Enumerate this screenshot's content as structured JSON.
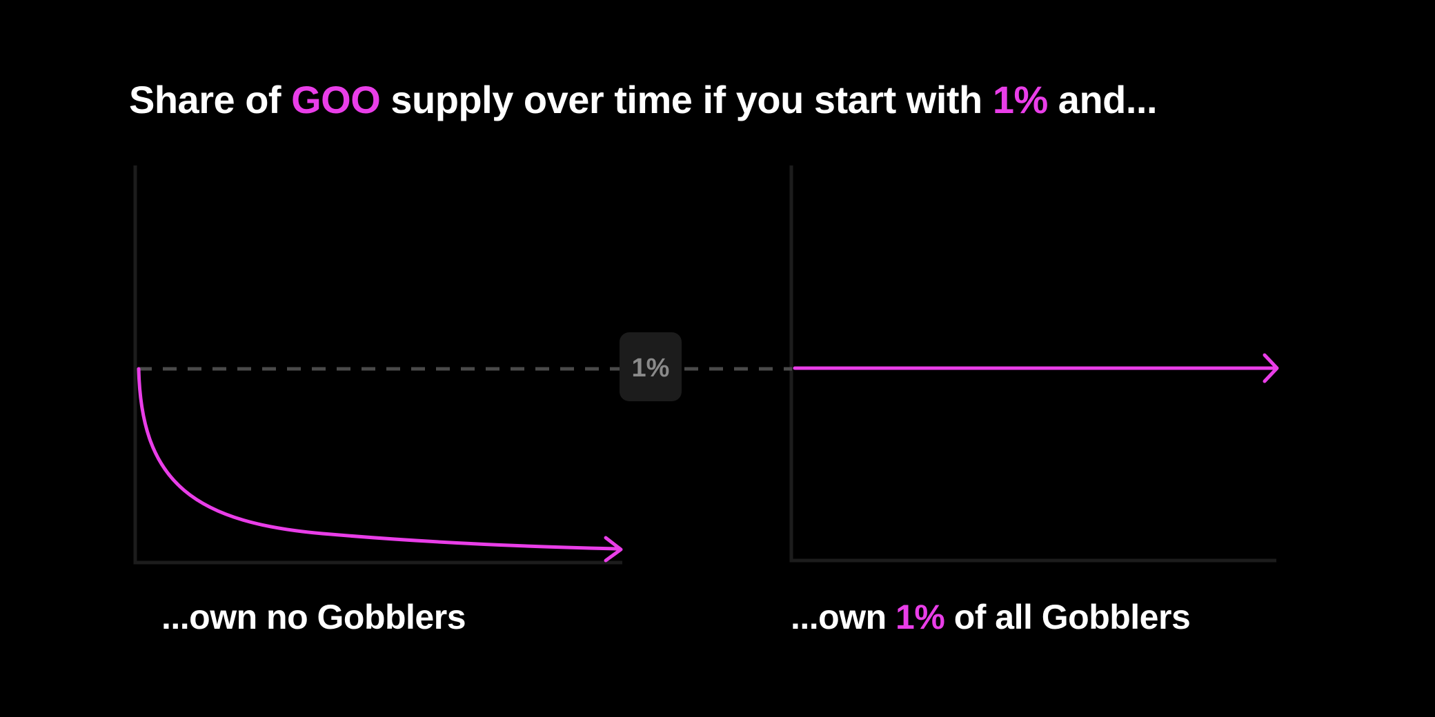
{
  "title": {
    "part1": "Share of ",
    "token": "GOO",
    "part2": " supply over time if you start with ",
    "percent": "1%",
    "part3": " and..."
  },
  "reference_label": "1%",
  "captions": {
    "left": "...own no Gobblers",
    "right": {
      "part1": "...own ",
      "percent": "1%",
      "part2": " of all Gobblers"
    }
  },
  "colors": {
    "background": "#000000",
    "accent": "#e93ee8",
    "axis": "#1c1c1c",
    "dashed_line": "#4a4a4a",
    "badge_bg": "#1c1c1c",
    "badge_text": "#8a8a8a"
  }
}
